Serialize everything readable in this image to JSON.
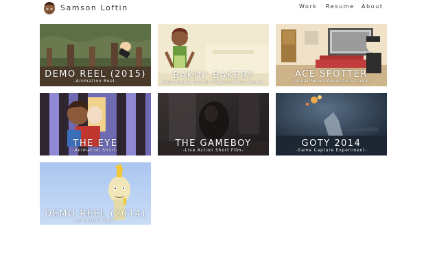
{
  "header": {
    "site_name": "Samson Loftin",
    "avatar_icon": "cartoon-face-avatar"
  },
  "nav": {
    "items": [
      {
        "label": "Work"
      },
      {
        "label": "Resume"
      },
      {
        "label": "About"
      }
    ]
  },
  "projects": [
    {
      "title": "DEMO REEL (2015)",
      "subtitle": "-Animation Reel-"
    },
    {
      "title": "BAKIN' BAKERY",
      "subtitle": "-Multimedia Senior Project/Visual Novel-"
    },
    {
      "title": "ACE SPOTTER",
      "subtitle": "-Visual Novel Adventure Game-"
    },
    {
      "title": "THE EYE",
      "subtitle": "-Animation Short-"
    },
    {
      "title": "THE GAMEBOY",
      "subtitle": "-Live Action Short Film-"
    },
    {
      "title": "GOTY 2014",
      "subtitle": "-Game Capture Experiment-"
    },
    {
      "title": "DEMO REEL (2014)",
      "subtitle": "-Animation Reel-"
    }
  ]
}
